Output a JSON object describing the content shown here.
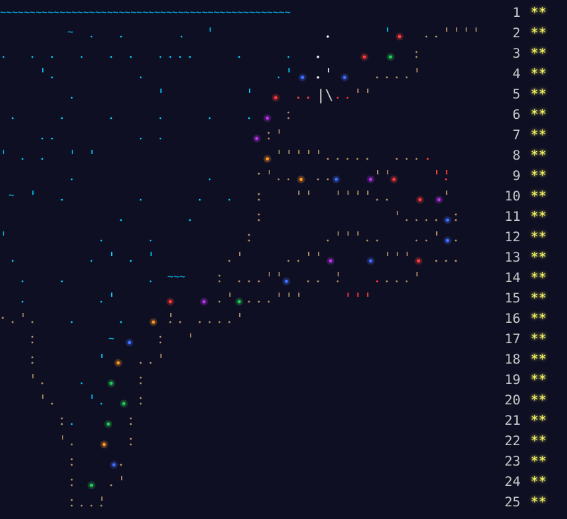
{
  "calendar": {
    "days": [
      {
        "day": "1",
        "stars": "**"
      },
      {
        "day": "2",
        "stars": "**"
      },
      {
        "day": "3",
        "stars": "**"
      },
      {
        "day": "4",
        "stars": "**"
      },
      {
        "day": "5",
        "stars": "**"
      },
      {
        "day": "6",
        "stars": "**"
      },
      {
        "day": "7",
        "stars": "**"
      },
      {
        "day": "8",
        "stars": "**"
      },
      {
        "day": "9",
        "stars": "**"
      },
      {
        "day": "10",
        "stars": "**"
      },
      {
        "day": "11",
        "stars": "**"
      },
      {
        "day": "12",
        "stars": "**"
      },
      {
        "day": "13",
        "stars": "**"
      },
      {
        "day": "14",
        "stars": "**"
      },
      {
        "day": "15",
        "stars": "**"
      },
      {
        "day": "16",
        "stars": "**"
      },
      {
        "day": "17",
        "stars": "**"
      },
      {
        "day": "18",
        "stars": "**"
      },
      {
        "day": "19",
        "stars": "**"
      },
      {
        "day": "20",
        "stars": "**"
      },
      {
        "day": "21",
        "stars": "**"
      },
      {
        "day": "22",
        "stars": "**"
      },
      {
        "day": "23",
        "stars": "**"
      },
      {
        "day": "24",
        "stars": "**"
      },
      {
        "day": "25",
        "stars": "**"
      }
    ]
  },
  "art": {
    "wave_row": "~~~~~~~~~~~~~~~~~~~~~~~~~~~~~~~~~~~~~~~~~~~~~~~~~",
    "mast_glyph": "|\\",
    "water_glyph": "~~~",
    "small_wave": "~",
    "colors": {
      "background": "#0f0f23",
      "sea": "#00ccff",
      "path": "#b09068",
      "white": "#ffffff",
      "gold_star": "#ffff66",
      "red": "#ff3b3b",
      "green": "#22cc55",
      "blue": "#3f6fff",
      "purple": "#bb33ee",
      "orange": "#ff9922",
      "text": "#cccccc"
    }
  }
}
